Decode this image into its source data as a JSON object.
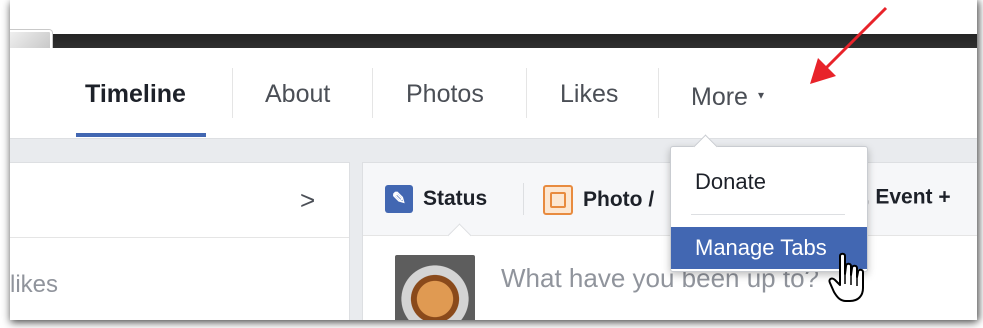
{
  "nav": {
    "tabs": [
      {
        "label": "Timeline",
        "active": true
      },
      {
        "label": "About",
        "active": false
      },
      {
        "label": "Photos",
        "active": false
      },
      {
        "label": "Likes",
        "active": false
      }
    ],
    "more_label": "More",
    "more_caret": "▾"
  },
  "dropdown": {
    "items": [
      {
        "label": "Donate",
        "highlighted": false
      },
      {
        "label": "Manage Tabs",
        "highlighted": true
      }
    ]
  },
  "left_card": {
    "chevron": ">",
    "likes_text": "likes"
  },
  "composer": {
    "actions": [
      {
        "label": "Status",
        "icon": "pencil-icon"
      },
      {
        "label": "Photo /",
        "icon": "photo-icon"
      },
      {
        "label": "er, Event +",
        "icon": ""
      }
    ],
    "placeholder": "What have you been up to?"
  },
  "colors": {
    "accent": "#4267b2",
    "annotation_arrow": "#e8232a",
    "photo_icon": "#e88b3f"
  }
}
